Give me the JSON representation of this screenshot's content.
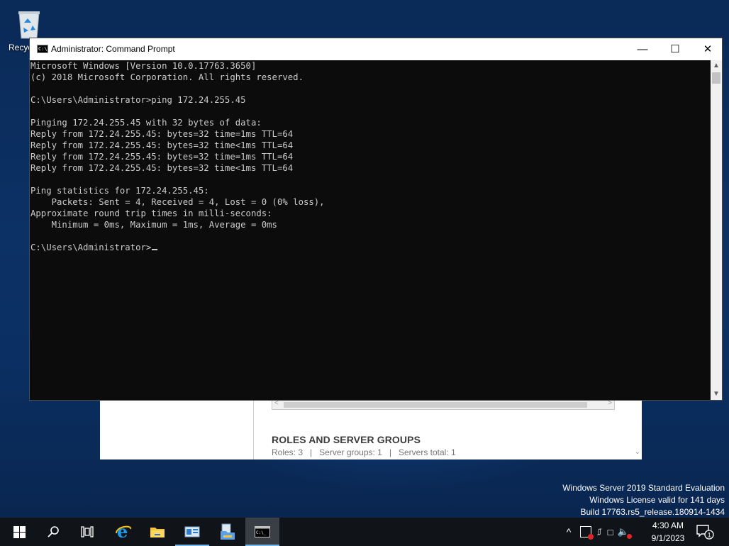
{
  "desktop": {
    "recycle_bin_label": "Recyc"
  },
  "server_manager": {
    "section_title": "ROLES AND SERVER GROUPS",
    "summary": "Roles: 3   |   Server groups: 1   |   Servers total: 1"
  },
  "watermark": {
    "line1": "Windows Server 2019 Standard Evaluation",
    "line2": "Windows License valid for 141 days",
    "line3": "Build 17763.rs5_release.180914-1434"
  },
  "cmd": {
    "title": "Administrator: Command Prompt",
    "lines": [
      "Microsoft Windows [Version 10.0.17763.3650]",
      "(c) 2018 Microsoft Corporation. All rights reserved.",
      "",
      "C:\\Users\\Administrator>ping 172.24.255.45",
      "",
      "Pinging 172.24.255.45 with 32 bytes of data:",
      "Reply from 172.24.255.45: bytes=32 time=1ms TTL=64",
      "Reply from 172.24.255.45: bytes=32 time<1ms TTL=64",
      "Reply from 172.24.255.45: bytes=32 time=1ms TTL=64",
      "Reply from 172.24.255.45: bytes=32 time<1ms TTL=64",
      "",
      "Ping statistics for 172.24.255.45:",
      "    Packets: Sent = 4, Received = 4, Lost = 0 (0% loss),",
      "Approximate round trip times in milli-seconds:",
      "    Minimum = 0ms, Maximum = 1ms, Average = 0ms",
      "",
      "C:\\Users\\Administrator>"
    ]
  },
  "taskbar": {
    "time": "4:30 AM",
    "date": "9/1/2023",
    "notification_count": "1"
  }
}
